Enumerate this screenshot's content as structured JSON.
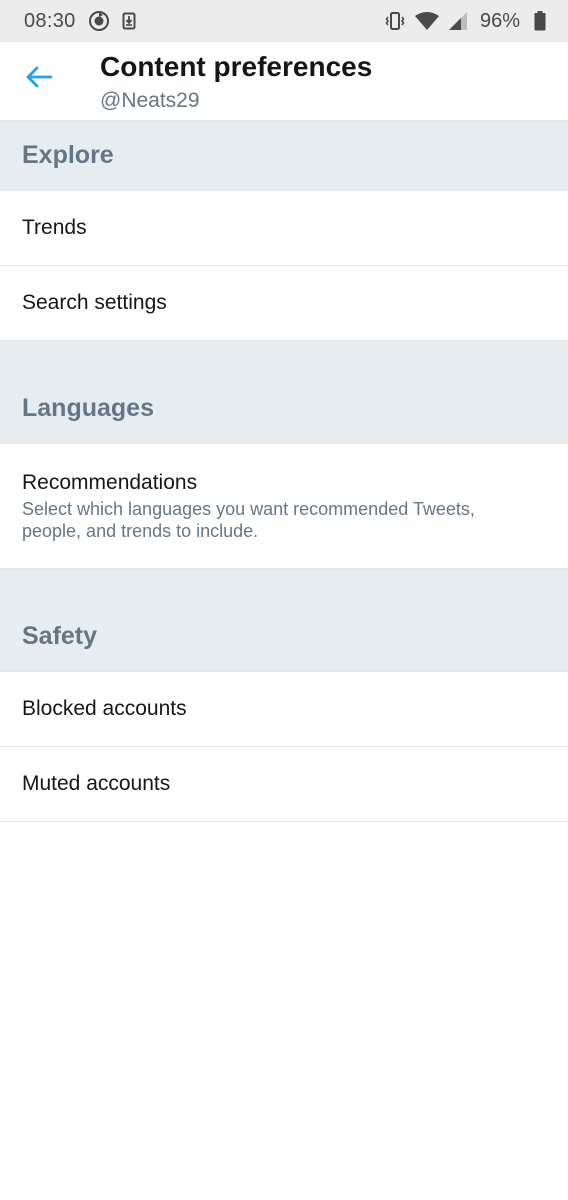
{
  "status_bar": {
    "time": "08:30",
    "battery_percent": "96%",
    "icons": [
      "sync-icon",
      "download-icon",
      "vibrate-icon",
      "wifi-icon",
      "signal-icon",
      "battery-icon"
    ]
  },
  "header": {
    "title": "Content preferences",
    "subtitle": "@Neats29",
    "back_icon": "arrow-left-icon",
    "accent_color": "#1da1f2"
  },
  "sections": {
    "explore": {
      "title": "Explore",
      "items": [
        {
          "label": "Trends"
        },
        {
          "label": "Search settings"
        }
      ]
    },
    "languages": {
      "title": "Languages",
      "items": [
        {
          "label": "Recommendations",
          "description": "Select which languages you want recommended Tweets, people, and trends to include."
        }
      ]
    },
    "safety": {
      "title": "Safety",
      "items": [
        {
          "label": "Blocked accounts"
        },
        {
          "label": "Muted accounts"
        }
      ]
    }
  },
  "colors": {
    "section_bg": "#e6ecf0",
    "section_text": "#657786",
    "divider": "#e1e8ed",
    "primary_text": "#14171a"
  }
}
